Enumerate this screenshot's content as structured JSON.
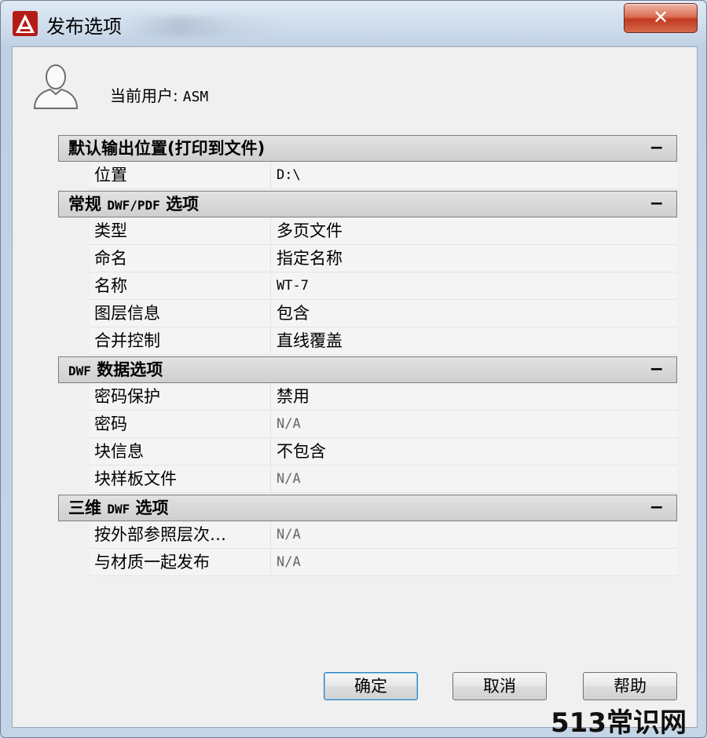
{
  "window": {
    "title": "发布选项",
    "close_label": "✕"
  },
  "user": {
    "label": "当前用户:",
    "value": "ASM"
  },
  "sections": [
    {
      "title": "默认输出位置(打印到文件)",
      "collapse": "−",
      "rows": [
        {
          "name": "位置",
          "value": "D:\\"
        }
      ]
    },
    {
      "title_prefix": "常规",
      "title_mono": "DWF/PDF",
      "title_suffix": "选项",
      "collapse": "−",
      "rows": [
        {
          "name": "类型",
          "value": "多页文件"
        },
        {
          "name": "命名",
          "value": "指定名称"
        },
        {
          "name": "名称",
          "value": "WT-7"
        },
        {
          "name": "图层信息",
          "value": "包含"
        },
        {
          "name": "合并控制",
          "value": "直线覆盖"
        }
      ]
    },
    {
      "title_mono": "DWF",
      "title_suffix": "数据选项",
      "collapse": "−",
      "rows": [
        {
          "name": "密码保护",
          "value": "禁用"
        },
        {
          "name": "密码",
          "value": "N/A"
        },
        {
          "name": "块信息",
          "value": "不包含"
        },
        {
          "name": "块样板文件",
          "value": "N/A"
        }
      ]
    },
    {
      "title_prefix": "三维",
      "title_mono": "DWF",
      "title_suffix": "选项",
      "collapse": "−",
      "rows": [
        {
          "name": "按外部参照层次…",
          "value": "N/A"
        },
        {
          "name": "与材质一起发布",
          "value": "N/A"
        }
      ]
    }
  ],
  "buttons": {
    "ok": "确定",
    "cancel": "取消",
    "help": "帮助"
  },
  "watermark": "513常识网",
  "colors": {
    "accent": "#3c7fb1",
    "close": "#c23a22",
    "app_icon": "#c8201c"
  },
  "icons": {
    "app": "autocad-logo-icon",
    "user": "user-silhouette-icon",
    "close": "close-icon"
  }
}
